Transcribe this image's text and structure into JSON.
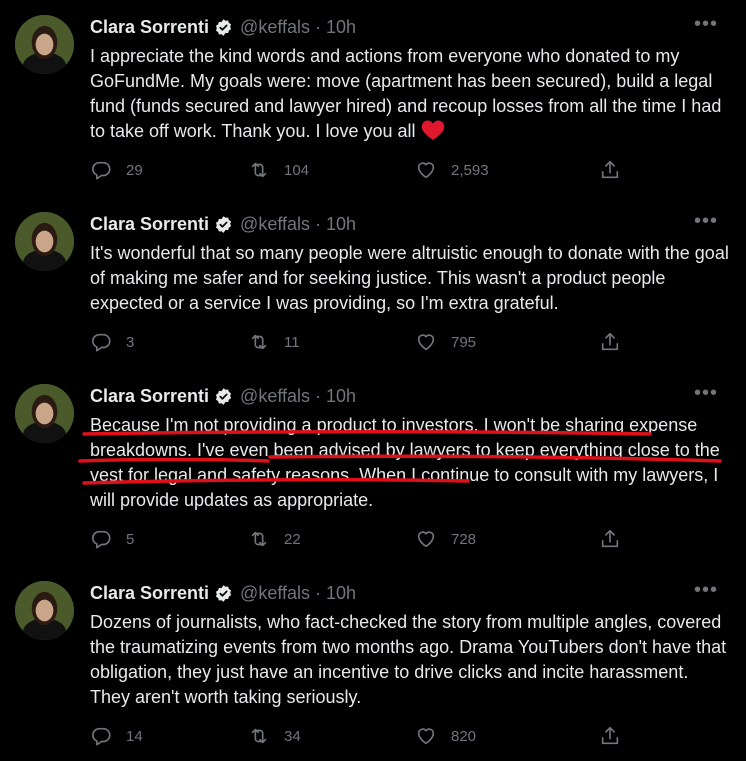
{
  "tweets": [
    {
      "name": "Clara Sorrenti",
      "handle": "@keffals",
      "separator": "·",
      "time": "10h",
      "text_before": "I appreciate the kind words and actions from everyone who donated to my GoFundMe. My goals were: move (apartment has been secured), build a legal fund (funds secured and lawyer hired) and recoup losses from all the time I had to take off work. Thank you. I love you all ",
      "emoji": "❤️",
      "replies": "29",
      "retweets": "104",
      "likes": "2,593"
    },
    {
      "name": "Clara Sorrenti",
      "handle": "@keffals",
      "separator": "·",
      "time": "10h",
      "text": "It's wonderful that so many people were altruistic enough to donate with the goal of making me safer and for seeking justice. This wasn't a product people expected or a service I was providing, so I'm extra grateful.",
      "replies": "3",
      "retweets": "11",
      "likes": "795"
    },
    {
      "name": "Clara Sorrenti",
      "handle": "@keffals",
      "separator": "·",
      "time": "10h",
      "text": "Because I'm not providing a product to investors, I won't be sharing expense breakdowns. I've even been advised by lawyers to keep everything close to the vest for legal and safety reasons. When I continue to consult with my lawyers, I will provide updates as appropriate.",
      "replies": "5",
      "retweets": "22",
      "likes": "728"
    },
    {
      "name": "Clara Sorrenti",
      "handle": "@keffals",
      "separator": "·",
      "time": "10h",
      "text": "Dozens of journalists, who fact-checked the story from multiple angles, covered the traumatizing events from two months ago. Drama YouTubers don't have that obligation, they just have an incentive to drive clicks and incite harassment. They aren't worth taking seriously.",
      "replies": "14",
      "retweets": "34",
      "likes": "820"
    }
  ],
  "colors": {
    "background": "#000000",
    "text": "#e7e9ea",
    "muted": "#71767b",
    "verified": "#e7e9ea",
    "annotation": "#e0101a"
  },
  "icons": [
    "reply-icon",
    "retweet-icon",
    "like-icon",
    "share-icon",
    "verified-badge-icon",
    "more-icon"
  ]
}
